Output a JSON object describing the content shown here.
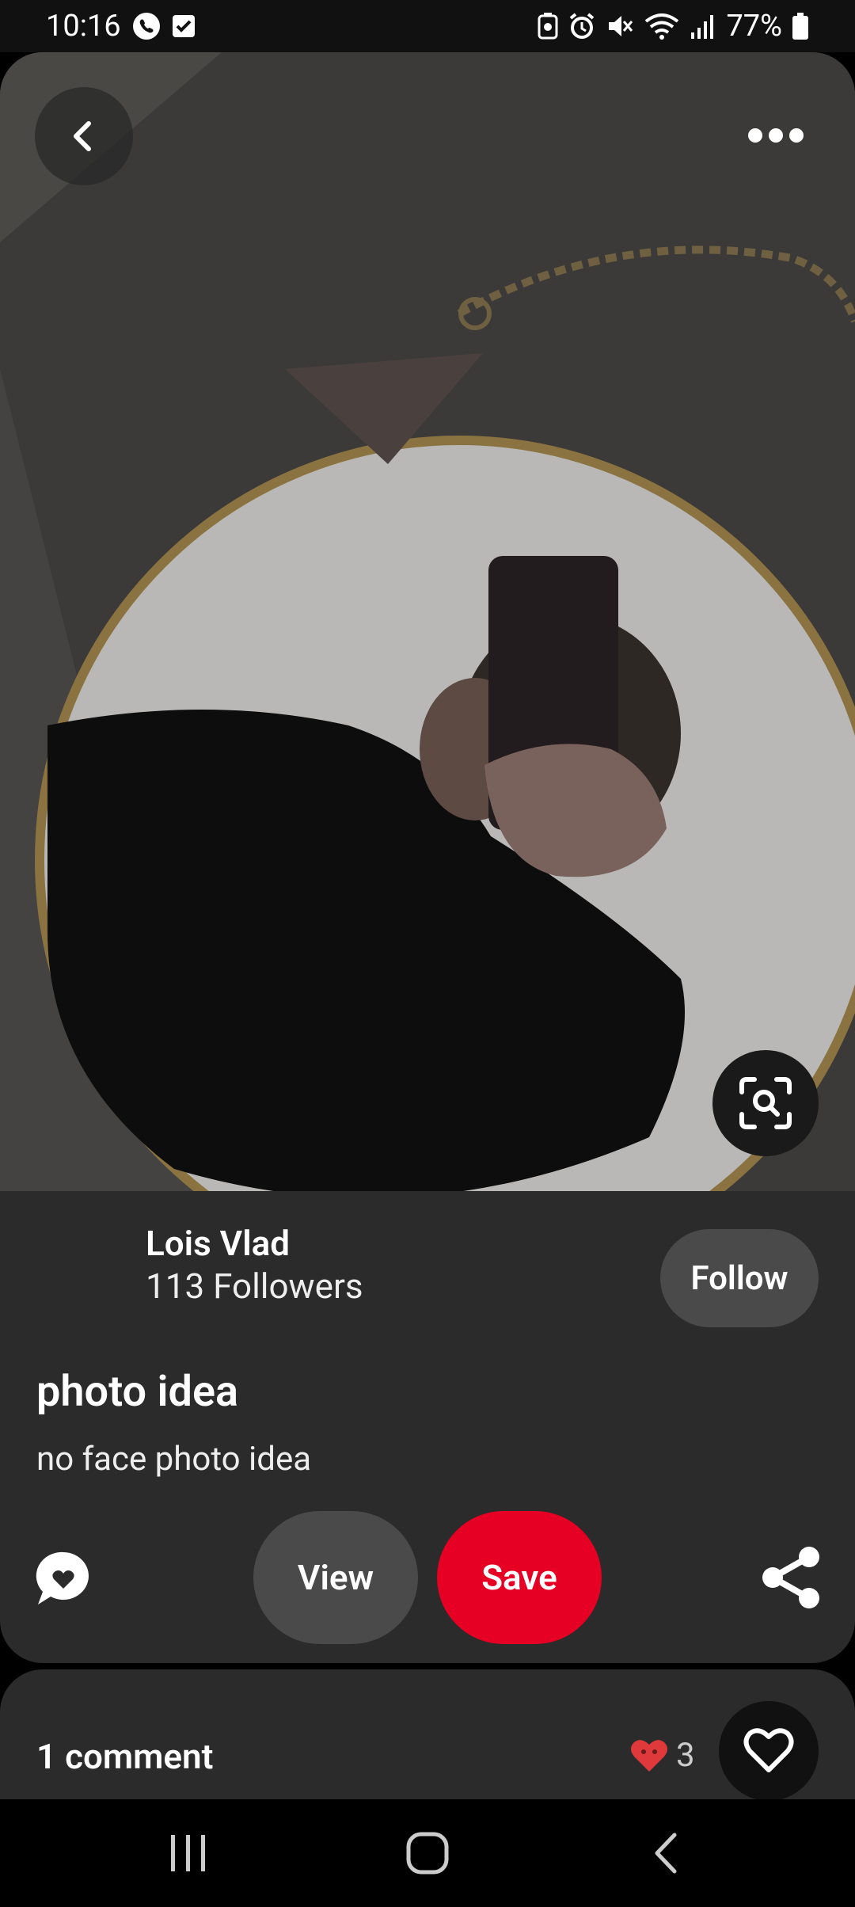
{
  "status_bar": {
    "time": "10:16",
    "battery": "77%"
  },
  "creator": {
    "name": "Lois Vlad",
    "followers": "113 Followers",
    "follow_label": "Follow"
  },
  "pin": {
    "title": "photo idea",
    "description": "no face photo idea"
  },
  "actions": {
    "view_label": "View",
    "save_label": "Save"
  },
  "comments": {
    "count_label": "1 comment",
    "reaction_count": "3"
  },
  "colors": {
    "accent": "#e60023",
    "card_bg": "#2b2b2b",
    "button_bg": "#4a4a4a"
  },
  "icons": [
    "back-icon",
    "more-icon",
    "visual-search-icon",
    "comment-icon",
    "share-icon",
    "heart-icon",
    "recents-icon",
    "home-icon",
    "nav-back-icon"
  ]
}
